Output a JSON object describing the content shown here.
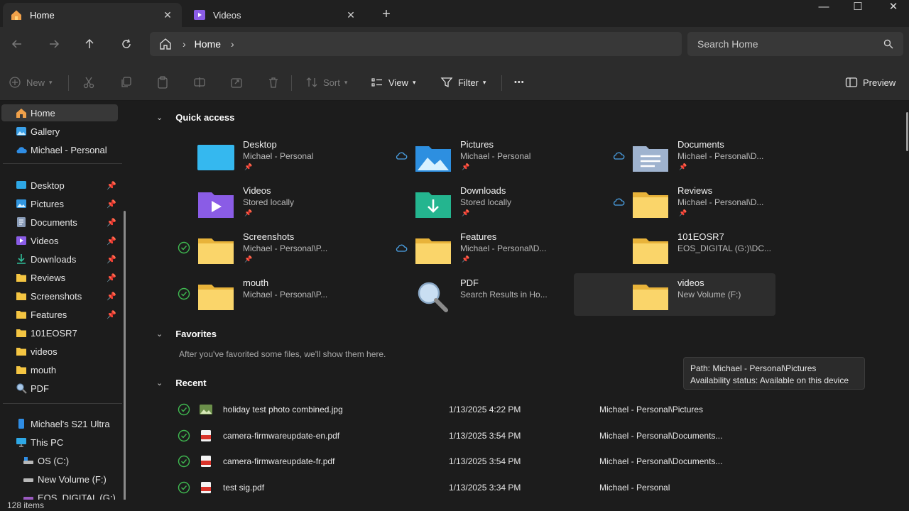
{
  "tabs": [
    {
      "label": "Home",
      "icon": "home-icon",
      "active": true
    },
    {
      "label": "Videos",
      "icon": "videos-folder-icon",
      "active": false
    }
  ],
  "window": {
    "minimize": "—",
    "maximize": "☐",
    "close": "✕",
    "new_tab": "+",
    "tab_close": "✕"
  },
  "address": {
    "crumb": "Home",
    "sep": "›"
  },
  "search": {
    "placeholder": "Search Home"
  },
  "toolbar": {
    "new": "New",
    "sort": "Sort",
    "view": "View",
    "filter": "Filter",
    "more": "•••",
    "preview": "Preview"
  },
  "sidebar": {
    "top": [
      {
        "label": "Home",
        "icon": "home-icon"
      },
      {
        "label": "Gallery",
        "icon": "gallery-icon"
      },
      {
        "label": "Michael - Personal",
        "icon": "onedrive-icon"
      }
    ],
    "pinned": [
      {
        "label": "Desktop",
        "icon": "desktop-icon",
        "pinned": true
      },
      {
        "label": "Pictures",
        "icon": "pictures-icon",
        "pinned": true
      },
      {
        "label": "Documents",
        "icon": "documents-icon",
        "pinned": true
      },
      {
        "label": "Videos",
        "icon": "videos-icon",
        "pinned": true
      },
      {
        "label": "Downloads",
        "icon": "downloads-icon",
        "pinned": true
      },
      {
        "label": "Reviews",
        "icon": "folder-icon",
        "pinned": true
      },
      {
        "label": "Screenshots",
        "icon": "folder-icon",
        "pinned": true
      },
      {
        "label": "Features",
        "icon": "folder-icon",
        "pinned": true
      },
      {
        "label": "101EOSR7",
        "icon": "folder-icon",
        "pinned": false
      },
      {
        "label": "videos",
        "icon": "folder-icon",
        "pinned": false
      },
      {
        "label": "mouth",
        "icon": "folder-icon",
        "pinned": false
      },
      {
        "label": "PDF",
        "icon": "search-icon",
        "pinned": false
      }
    ],
    "devices": [
      {
        "label": "Michael's S21 Ultra",
        "icon": "phone-icon"
      },
      {
        "label": "This PC",
        "icon": "pc-icon"
      },
      {
        "label": "OS (C:)",
        "icon": "drive-icon"
      },
      {
        "label": "New Volume (F:)",
        "icon": "drive-icon"
      },
      {
        "label": "EOS_DIGITAL (G:)",
        "icon": "drive-icon"
      }
    ]
  },
  "sections": {
    "quick_access": "Quick access",
    "favorites": "Favorites",
    "recent": "Recent"
  },
  "quick_access": [
    {
      "name": "Desktop",
      "sub": "Michael - Personal",
      "pinned": true,
      "status": "",
      "icon": "desktop"
    },
    {
      "name": "Pictures",
      "sub": "Michael - Personal",
      "pinned": true,
      "status": "cloud",
      "icon": "pictures"
    },
    {
      "name": "Documents",
      "sub": "Michael - Personal\\D...",
      "pinned": true,
      "status": "cloud",
      "icon": "documents"
    },
    {
      "name": "Videos",
      "sub": "Stored locally",
      "pinned": true,
      "status": "",
      "icon": "videos"
    },
    {
      "name": "Downloads",
      "sub": "Stored locally",
      "pinned": true,
      "status": "",
      "icon": "downloads"
    },
    {
      "name": "Reviews",
      "sub": "Michael - Personal\\D...",
      "pinned": true,
      "status": "cloud",
      "icon": "folder"
    },
    {
      "name": "Screenshots",
      "sub": "Michael - Personal\\P...",
      "pinned": true,
      "status": "check",
      "icon": "folder"
    },
    {
      "name": "Features",
      "sub": "Michael - Personal\\D...",
      "pinned": true,
      "status": "cloud",
      "icon": "folder"
    },
    {
      "name": "101EOSR7",
      "sub": "EOS_DIGITAL (G:)\\DC...",
      "pinned": false,
      "status": "",
      "icon": "folder"
    },
    {
      "name": "mouth",
      "sub": "Michael - Personal\\P...",
      "pinned": false,
      "status": "check",
      "icon": "folder"
    },
    {
      "name": "PDF",
      "sub": "Search Results in Ho...",
      "pinned": false,
      "status": "",
      "icon": "search"
    },
    {
      "name": "videos",
      "sub": "New Volume (F:)",
      "pinned": false,
      "status": "",
      "icon": "folder"
    }
  ],
  "favorites_note": "After you've favorited some files, we'll show them here.",
  "recent": [
    {
      "name": "holiday test photo combined.jpg",
      "date": "1/13/2025 4:22 PM",
      "location": "Michael - Personal\\Pictures",
      "icon": "image"
    },
    {
      "name": "camera-firmwareupdate-en.pdf",
      "date": "1/13/2025 3:54 PM",
      "location": "Michael - Personal\\Documents...",
      "icon": "pdf"
    },
    {
      "name": "camera-firmwareupdate-fr.pdf",
      "date": "1/13/2025 3:54 PM",
      "location": "Michael - Personal\\Documents...",
      "icon": "pdf"
    },
    {
      "name": "test sig.pdf",
      "date": "1/13/2025 3:34 PM",
      "location": "Michael - Personal",
      "icon": "pdf"
    }
  ],
  "tooltip": {
    "path": "Path: Michael - Personal\\Pictures",
    "availability": "Availability status: Available on this device"
  },
  "status": {
    "items": "128 items"
  },
  "colors": {
    "folder": "#f4c542",
    "accent": "#4cc2ff",
    "check": "#3fb950",
    "pdf": "#d9342b"
  }
}
